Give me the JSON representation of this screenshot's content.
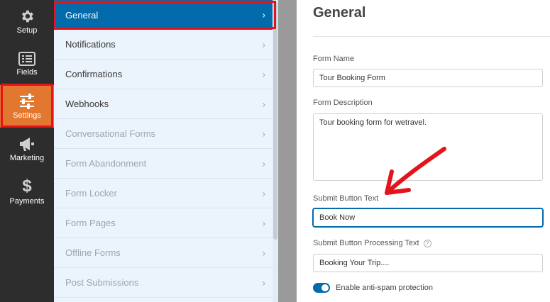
{
  "sidebar": {
    "items": [
      {
        "label": "Setup",
        "icon": "gear-icon"
      },
      {
        "label": "Fields",
        "icon": "fields-icon"
      },
      {
        "label": "Settings",
        "icon": "sliders-icon",
        "active": true
      },
      {
        "label": "Marketing",
        "icon": "megaphone-icon"
      },
      {
        "label": "Payments",
        "icon": "dollar-icon"
      }
    ],
    "active_color": "#e27730"
  },
  "menu": {
    "items": [
      {
        "label": "General",
        "active": true
      },
      {
        "label": "Notifications"
      },
      {
        "label": "Confirmations"
      },
      {
        "label": "Webhooks"
      },
      {
        "label": "Conversational Forms",
        "dim": true
      },
      {
        "label": "Form Abandonment",
        "dim": true
      },
      {
        "label": "Form Locker",
        "dim": true
      },
      {
        "label": "Form Pages",
        "dim": true
      },
      {
        "label": "Offline Forms",
        "dim": true
      },
      {
        "label": "Post Submissions",
        "dim": true
      }
    ],
    "chevron": "›"
  },
  "panel": {
    "title": "General",
    "form_name_label": "Form Name",
    "form_name_value": "Tour Booking Form",
    "form_description_label": "Form Description",
    "form_description_value": "Tour booking form for wetravel.",
    "submit_text_label": "Submit Button Text",
    "submit_text_value": "Book Now",
    "processing_text_label": "Submit Button Processing Text",
    "processing_text_value": "Booking Your Trip....",
    "antispam_label": "Enable anti-spam protection",
    "antispam_enabled": true
  },
  "colors": {
    "accent_blue": "#036aab",
    "highlight_red": "#e3141b",
    "arrow_red": "#e3141b"
  }
}
